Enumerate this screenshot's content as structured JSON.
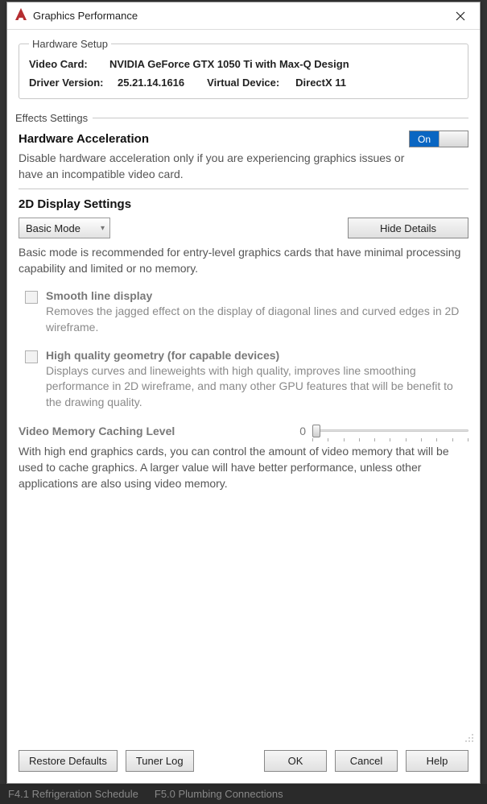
{
  "window": {
    "title": "Graphics Performance"
  },
  "hardware": {
    "legend": "Hardware Setup",
    "video_card_label": "Video Card:",
    "video_card_value": "NVIDIA GeForce GTX 1050 Ti with Max-Q Design",
    "driver_label": "Driver Version:",
    "driver_value": "25.21.14.1616",
    "virtual_device_label": "Virtual Device:",
    "virtual_device_value": "DirectX 11"
  },
  "effects": {
    "legend": "Effects Settings",
    "hw_accel_title": "Hardware Acceleration",
    "hw_accel_toggle_label": "On",
    "hw_accel_toggle_state": true,
    "hw_accel_desc": "Disable hardware acceleration only if you are experiencing graphics issues or have an incompatible video card.",
    "d2_title": "2D Display Settings",
    "mode_selected": "Basic Mode",
    "hide_details_label": "Hide Details",
    "mode_desc": "Basic mode is recommended for entry-level graphics cards that have minimal processing capability and limited or no memory.",
    "opts": [
      {
        "checked": false,
        "title": "Smooth line display",
        "desc": "Removes the jagged effect on the display of diagonal lines and curved edges in 2D wireframe."
      },
      {
        "checked": false,
        "title": "High quality geometry (for capable devices)",
        "desc": "Displays curves and lineweights with high quality, improves line smoothing performance in 2D wireframe, and many other GPU features that will be benefit to the drawing quality."
      }
    ],
    "vm_label": "Video Memory Caching Level",
    "vm_value": "0",
    "vm_desc": "With high end graphics cards, you can control the amount of video memory that will be used to cache graphics.  A larger value will have better performance, unless other applications are also using video memory."
  },
  "footer": {
    "restore_defaults": "Restore Defaults",
    "tuner_log": "Tuner Log",
    "ok": "OK",
    "cancel": "Cancel",
    "help": "Help"
  },
  "background_tabs": {
    "tab1": "F4.1  Refrigeration Schedule",
    "tab2": "F5.0  Plumbing Connections"
  }
}
